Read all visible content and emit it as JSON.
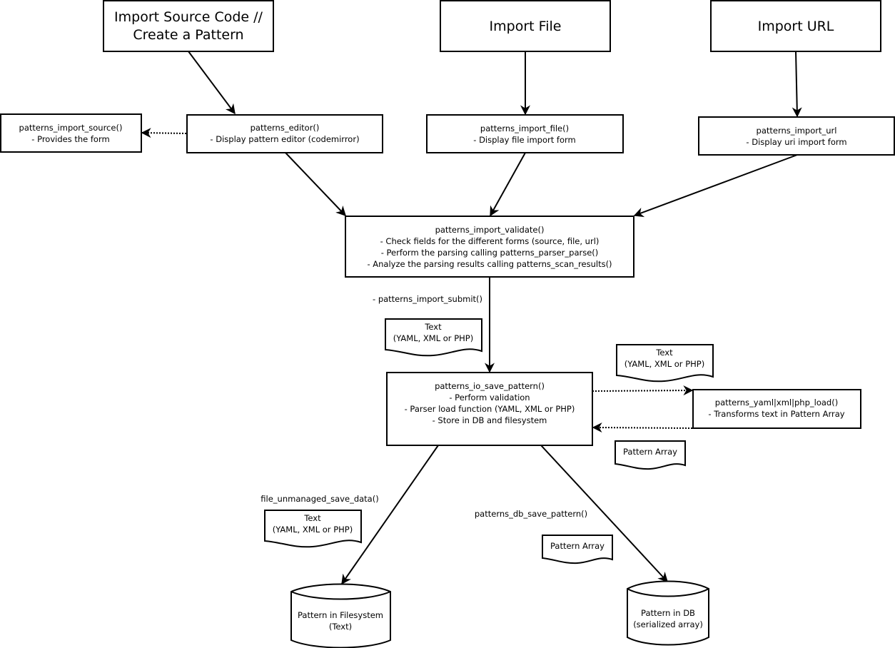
{
  "nodes": {
    "import_source": [
      "Import Source Code //",
      "Create a Pattern"
    ],
    "import_file": [
      "Import File"
    ],
    "import_url": [
      "Import URL"
    ],
    "patterns_import_source": [
      "patterns_import_source()",
      "- Provides the form"
    ],
    "patterns_editor": [
      "patterns_editor()",
      "- Display pattern editor (codemirror)"
    ],
    "patterns_import_file": [
      "patterns_import_file()",
      "- Display file import form"
    ],
    "patterns_import_url": [
      "patterns_import_url",
      "- Display uri import form"
    ],
    "patterns_import_validate": [
      "patterns_import_validate()",
      "- Check fields for the different forms (source, file, url)",
      "- Perform the parsing calling patterns_parser_parse()",
      "- Analyze the parsing results calling patterns_scan_results()"
    ],
    "patterns_io_save_pattern": [
      "patterns_io_save_pattern()",
      "- Perform validation",
      "- Parser load function (YAML, XML or PHP)",
      "- Store in DB and filesystem"
    ],
    "patterns_load": [
      "patterns_yaml|xml|php_load()",
      "- Transforms text in Pattern Array"
    ],
    "filesystem": [
      "Pattern in Filesystem",
      "(Text)"
    ],
    "db": [
      "Pattern in DB",
      "(serialized array)"
    ]
  },
  "documents": {
    "text_submit": [
      "Text",
      "(YAML, XML or PHP)"
    ],
    "text_load": [
      "Text",
      "(YAML, XML or PHP)"
    ],
    "array_load": [
      "Pattern Array"
    ],
    "text_fs": [
      "Text",
      "(YAML, XML or PHP)"
    ],
    "array_db": [
      "Pattern Array"
    ]
  },
  "edge_labels": {
    "submit": "- patterns_import_submit()",
    "file_save": "file_unmanaged_save_data()",
    "db_save": "patterns_db_save_pattern()"
  }
}
